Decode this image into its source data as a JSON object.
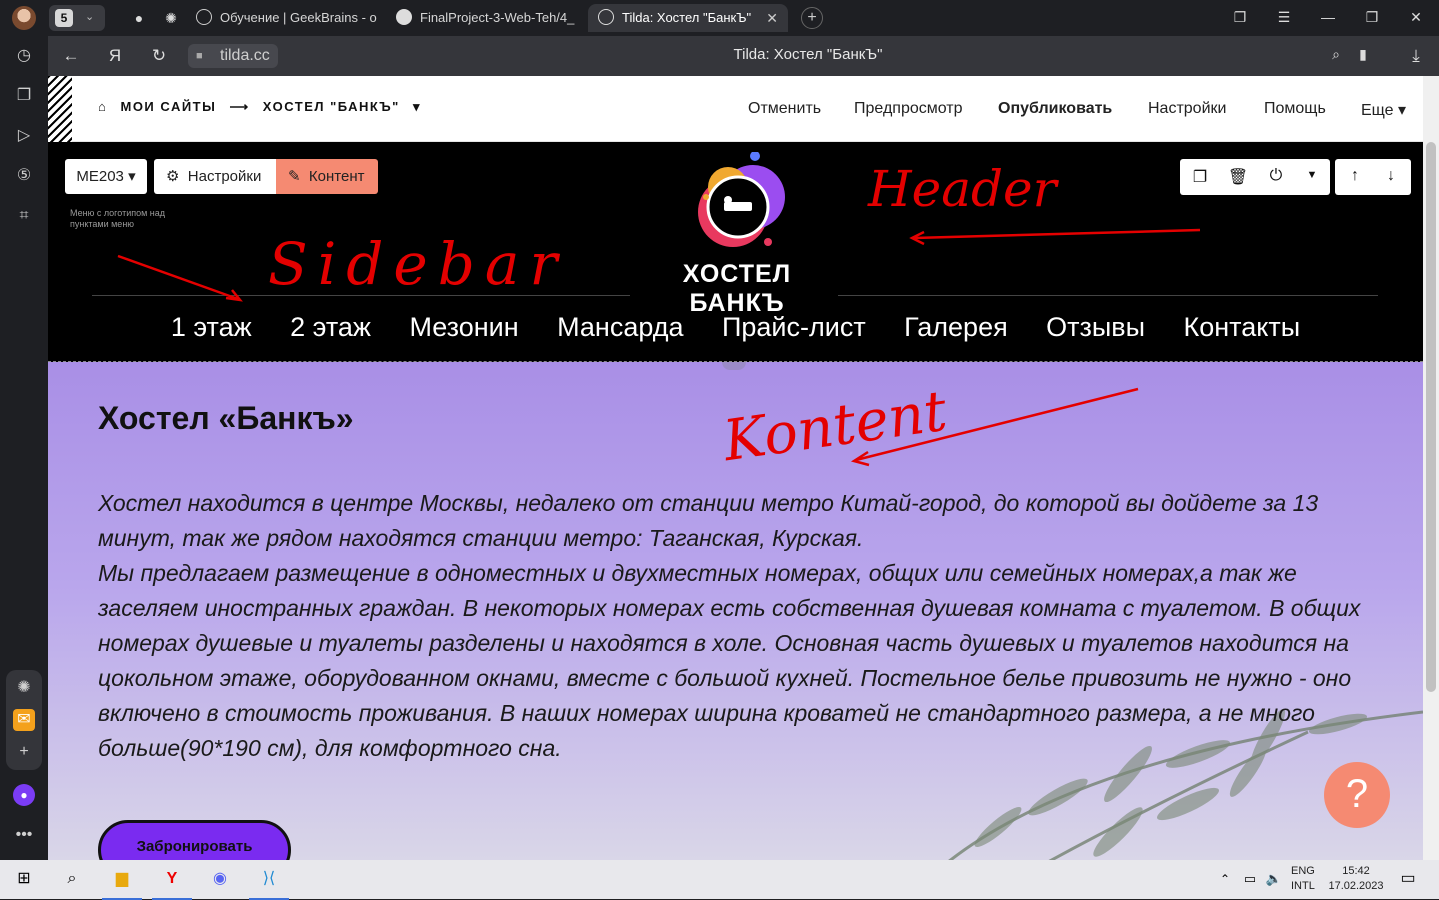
{
  "browser": {
    "tab_count": "5",
    "tabs": [
      {
        "title": "Обучение | GeekBrains - o"
      },
      {
        "title": "FinalProject-3-Web-Teh/4_"
      },
      {
        "title": "Tilda: Хостел \"БанкЪ\"",
        "active": true
      }
    ],
    "url": "tilda.cc",
    "page_title": "Tilda: Хостел \"БанкЪ\""
  },
  "tilda": {
    "breadcrumb_root": "МОИ САЙТЫ",
    "breadcrumb_arrow": "⟶",
    "breadcrumb_site": "ХОСТЕЛ \"БАНКЪ\"",
    "menu": [
      "Отменить",
      "Предпросмотр",
      "Опубликовать",
      "Настройки",
      "Помощь",
      "Еще"
    ]
  },
  "header_block": {
    "block_code": "ME203",
    "settings_label": "Настройки",
    "content_label": "Контент",
    "hint": "Меню с логотипом над пунктами меню",
    "logo_text": "ХОСТЕЛ БАНКЪ",
    "nav": [
      "1 этаж",
      "2 этаж",
      "Мезонин",
      "Мансарда",
      "Прайс-лист",
      "Галерея",
      "Отзывы",
      "Контакты"
    ]
  },
  "content_block": {
    "title": "Хостел «Банкъ»",
    "paragraph1": "Хостел находится в центре Москвы, недалеко от станции метро Китай-город, до которой вы дойдете за 13 минут, так же рядом находятся станции метро: Таганская, Курская.",
    "paragraph2": "Мы предлагаем размещение в одноместных и двухместных номерах, общих или семейных номерах,а так же заселяем иностранных граждан. В некоторых номерах есть собственная душевая комната с туалетом. В общих номерах душевые и туалеты разделены и находятся в холе. Основная часть душевых и туалетов находится на цокольном этаже, оборудованном окнами, вместе с большой кухней. Постельное белье привозить не нужно - оно включено в стоимость проживания. В наших номерах ширина кроватей не стандартного размера, а не много больше(90*190 см), для комфортного сна.",
    "button": "Забронировать",
    "help": "?"
  },
  "annotations": {
    "header": "Header",
    "sidebar": "Sidebar",
    "content": "Kontent"
  },
  "taskbar": {
    "lang1": "ENG",
    "lang2": "INTL",
    "time": "15:42",
    "date": "17.02.2023"
  },
  "colors": {
    "content_gradient_top": "#a98fe6",
    "button_purple": "#7a2bf0",
    "content_tab_orange": "#f58a72",
    "annotation_red": "#e40000"
  }
}
